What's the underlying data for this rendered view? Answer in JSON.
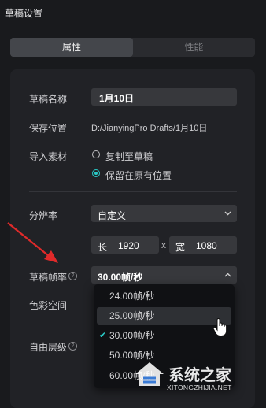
{
  "titlebar": {
    "title": "草稿设置"
  },
  "tabs": [
    {
      "label": "属性",
      "active": true
    },
    {
      "label": "性能",
      "active": false
    }
  ],
  "settings": {
    "draft_name": {
      "label": "草稿名称",
      "value": "1月10日"
    },
    "save_location": {
      "label": "保存位置",
      "value": "D:/JianyingPro Drafts/1月10日"
    },
    "import_material": {
      "label": "导入素材",
      "options": [
        {
          "label": "复制至草稿",
          "selected": false
        },
        {
          "label": "保留在原有位置",
          "selected": true
        }
      ]
    },
    "resolution": {
      "label": "分辨率",
      "preset": "自定义",
      "width_label": "长",
      "width": "1920",
      "times": "x",
      "height_label": "宽",
      "height": "1080"
    },
    "frame_rate": {
      "label": "草稿帧率",
      "value": "30.00帧/秒",
      "options": [
        {
          "label": "24.00帧/秒",
          "selected": false,
          "hover": false
        },
        {
          "label": "25.00帧/秒",
          "selected": false,
          "hover": true
        },
        {
          "label": "30.00帧/秒",
          "selected": true,
          "hover": false
        },
        {
          "label": "50.00帧/秒",
          "selected": false,
          "hover": false
        },
        {
          "label": "60.00帧/秒",
          "selected": false,
          "hover": false
        }
      ]
    },
    "color_space": {
      "label": "色彩空间"
    },
    "free_layer": {
      "label": "自由层级"
    }
  },
  "watermark": {
    "brand": "系统之家",
    "url": "XITONGZHIJIA.NET"
  },
  "colors": {
    "accent": "#29c8c4",
    "annotation_arrow": "#e02a2a",
    "background": "#191a1d"
  }
}
